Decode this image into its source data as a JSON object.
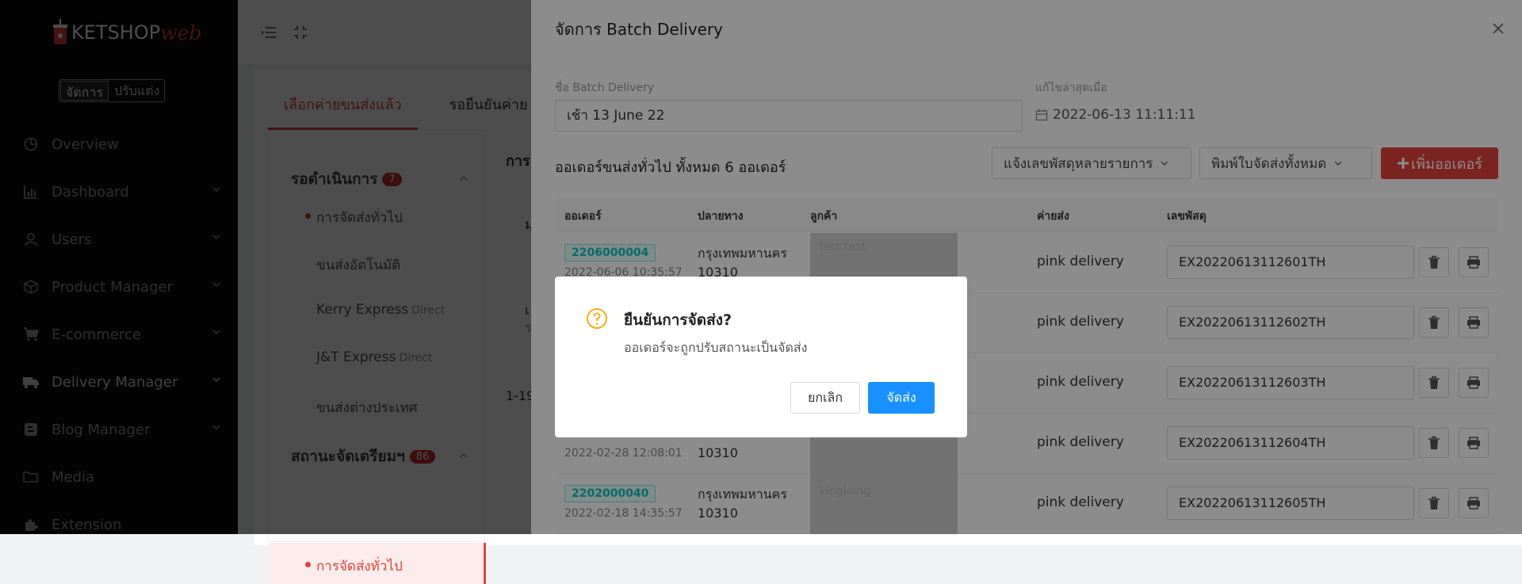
{
  "sidebar": {
    "brand": "KETSHOP",
    "brand_suffix": "web",
    "mode_manage": "จัดการ",
    "mode_customize": "ปรับแต่ง",
    "items": [
      {
        "label": "Overview",
        "icon": "pie-chart-icon",
        "has_children": false
      },
      {
        "label": "Dashboard",
        "icon": "bar-chart-icon",
        "has_children": true
      },
      {
        "label": "Users",
        "icon": "user-icon",
        "has_children": true
      },
      {
        "label": "Product Manager",
        "icon": "box-icon",
        "has_children": true
      },
      {
        "label": "E-commerce",
        "icon": "cart-icon",
        "has_children": true
      },
      {
        "label": "Delivery Manager",
        "icon": "truck-icon",
        "has_children": true
      },
      {
        "label": "Blog Manager",
        "icon": "blog-icon",
        "has_children": true
      },
      {
        "label": "Media",
        "icon": "folder-icon",
        "has_children": false
      },
      {
        "label": "Extension",
        "icon": "puzzle-icon",
        "has_children": false
      }
    ]
  },
  "page": {
    "tabs": [
      "เลือกค่ายขนส่งแล้ว",
      "รอยืนยันค่าย"
    ],
    "section1": {
      "title": "รอดำเนินการ",
      "count": "7"
    },
    "section1_items": [
      {
        "label": "การจัดส่งทั่วไป",
        "tag": ""
      },
      {
        "label": "ขนส่งอัตโนมัติ",
        "tag": ""
      },
      {
        "label": "Kerry Express",
        "tag": "Direct"
      },
      {
        "label": "J&T Express",
        "tag": "Direct"
      },
      {
        "label": "ขนส่งต่างประเทศ",
        "tag": ""
      }
    ],
    "section2": {
      "title": "สถานะจัดเตรียมฯ",
      "count": "86"
    },
    "section2_item": "การจัดส่งทั่วไป",
    "frag_title": "การ",
    "frag_a": "มุ",
    "frag_b": "เ",
    "frag_c": "ร",
    "frag_pager": "1-19"
  },
  "drawer": {
    "title": "จัดการ Batch Delivery",
    "name_label": "ชื่อ Batch Delivery",
    "name_value": "เช้า 13 June 22",
    "updated_label": "แก้ไขล่าสุดเมื่อ",
    "updated_value": "2022-06-13 11:11:11",
    "order_count_text": "ออเดอร์ขนส่งทั่วไป ทั้งหมด 6 ออเดอร์",
    "btn_notify": "แจ้งเลขพัสดุหลายรายการ",
    "btn_print": "พิมพ์ใบจัดส่งทั้งหมด",
    "btn_add": "เพิ่มออเดอร์",
    "columns": [
      "ออเดอร์",
      "ปลายทาง",
      "ลูกค้า",
      "ค่ายส่ง",
      "เลขพัสดุ"
    ],
    "rows": [
      {
        "order": "2206000004",
        "date": "2022-06-06 10:35:57",
        "city": "กรุงเทพมหานคร",
        "zip": "10310",
        "customer": "test test",
        "carrier": "pink delivery",
        "tracking": "EX20220613112601TH"
      },
      {
        "order": "",
        "date": "",
        "city": "",
        "zip": "",
        "customer": "",
        "carrier": "pink delivery",
        "tracking": "EX20220613112602TH"
      },
      {
        "order": "",
        "date": "",
        "city": "",
        "zip": "",
        "customer": "",
        "carrier": "pink delivery",
        "tracking": "EX20220613112603TH"
      },
      {
        "order": "",
        "date": "2022-02-28 12:08:01",
        "city": "",
        "zip": "10310",
        "customer": "",
        "carrier": "pink delivery",
        "tracking": "EX20220613112604TH"
      },
      {
        "order": "2202000040",
        "date": "2022-02-18 14:35:57",
        "city": "กรุงเทพมหานคร",
        "zip": "10310",
        "customer": "kingkong",
        "carrier": "pink delivery",
        "tracking": "EX20220613112605TH"
      }
    ]
  },
  "modal": {
    "title": "ยืนยันการจัดส่ง?",
    "message": "ออเดอร์จะถูกปรับสถานะเป็นจัดส่ง",
    "cancel": "ยกเลิก",
    "confirm": "จัดส่ง"
  },
  "colors": {
    "brand_red": "#e2423c",
    "primary_blue": "#1890ff",
    "warning_gold": "#faad14",
    "tag_teal": "#13c2c2",
    "sidebar_bg": "#0c0c0c"
  }
}
